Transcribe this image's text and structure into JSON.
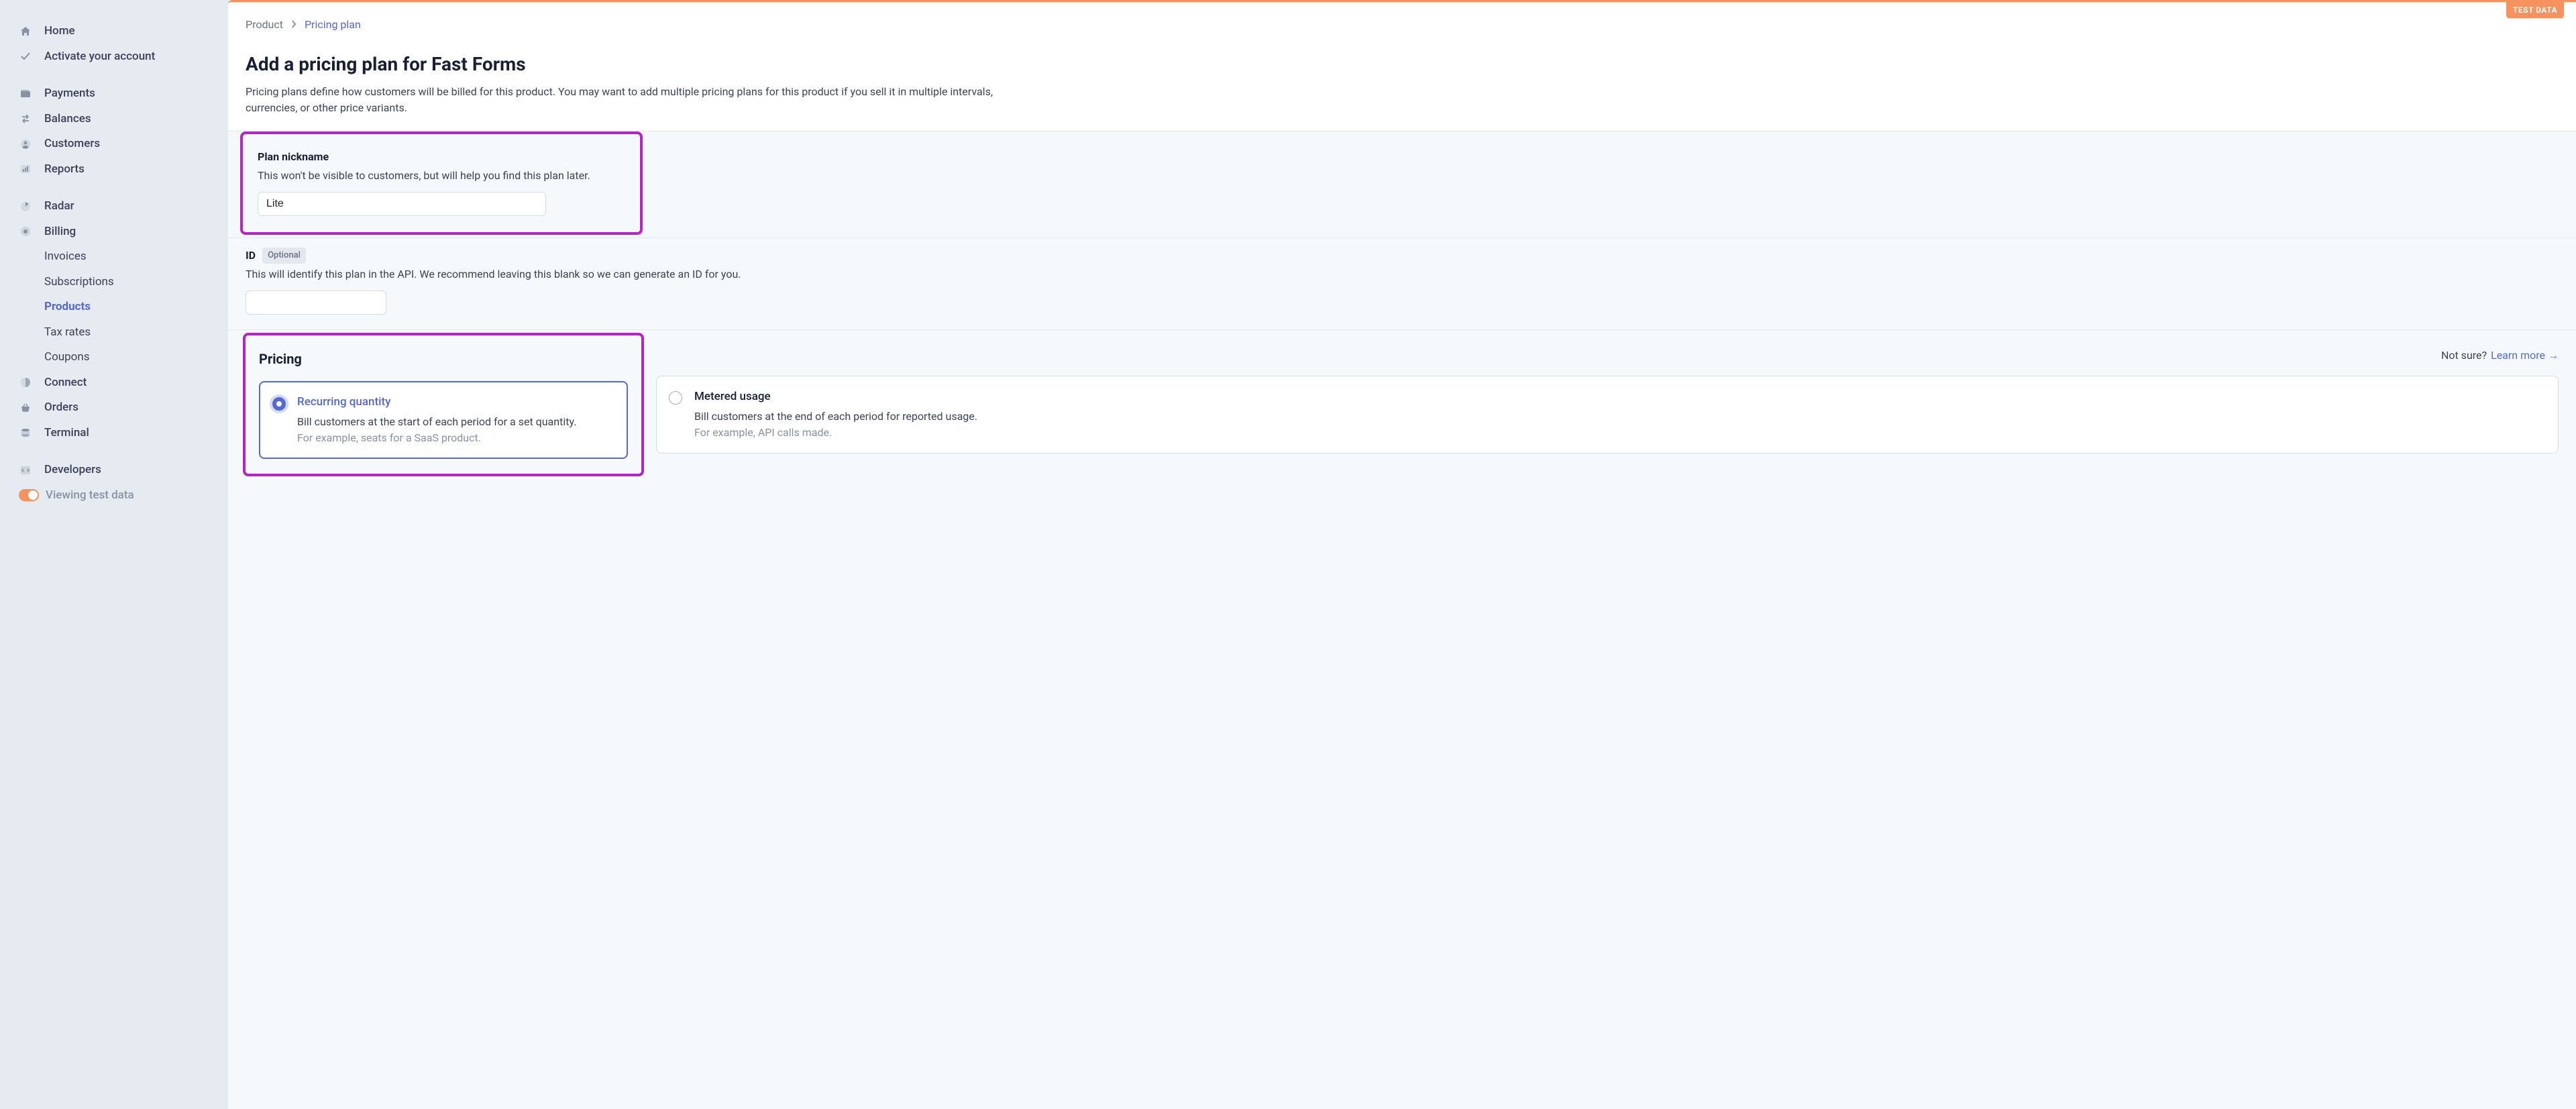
{
  "test_badge": "TEST DATA",
  "sidebar": {
    "home": "Home",
    "activate": "Activate your account",
    "payments": "Payments",
    "balances": "Balances",
    "customers": "Customers",
    "reports": "Reports",
    "radar": "Radar",
    "billing": "Billing",
    "billing_sub": {
      "invoices": "Invoices",
      "subscriptions": "Subscriptions",
      "products": "Products",
      "tax_rates": "Tax rates",
      "coupons": "Coupons"
    },
    "connect": "Connect",
    "orders": "Orders",
    "terminal": "Terminal",
    "developers": "Developers",
    "viewing_test": "Viewing test data"
  },
  "breadcrumb": {
    "product": "Product",
    "pricing_plan": "Pricing plan"
  },
  "header": {
    "title": "Add a pricing plan for Fast Forms",
    "desc": "Pricing plans define how customers will be billed for this product. You may want to add multiple pricing plans for this product if you sell it in multiple intervals, currencies, or other price variants."
  },
  "nickname": {
    "label": "Plan nickname",
    "help": "This won't be visible to customers, but will help you find this plan later.",
    "value": "Lite"
  },
  "id_field": {
    "label": "ID",
    "optional": "Optional",
    "help": "This will identify this plan in the API. We recommend leaving this blank so we can generate an ID for you.",
    "value": ""
  },
  "pricing": {
    "title": "Pricing",
    "not_sure": "Not sure?",
    "learn_more": "Learn more",
    "option_recurring": {
      "title": "Recurring quantity",
      "desc": "Bill customers at the start of each period for a set quantity.",
      "example": "For example, seats for a SaaS product."
    },
    "option_metered": {
      "title": "Metered usage",
      "desc": "Bill customers at the end of each period for reported usage.",
      "example": "For example, API calls made."
    }
  }
}
